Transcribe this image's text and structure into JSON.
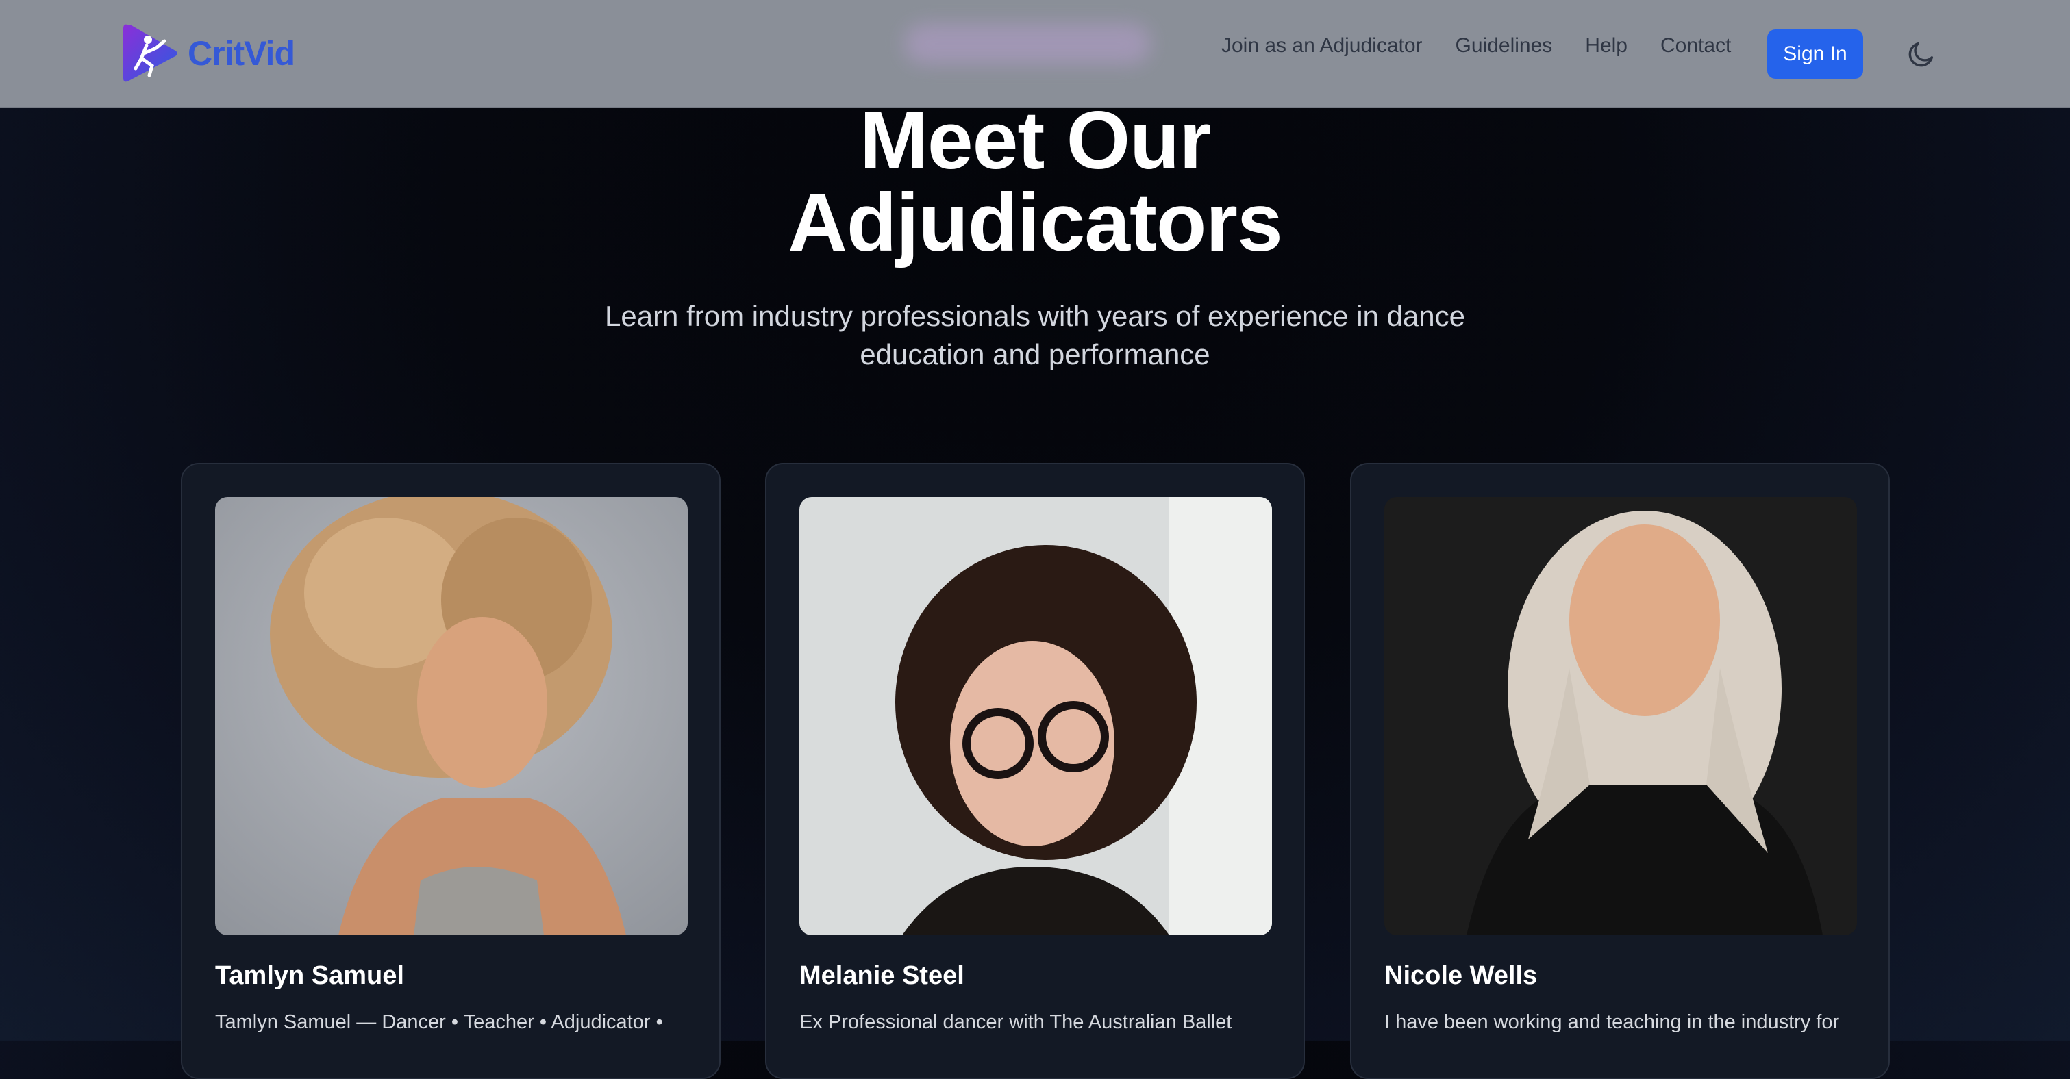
{
  "brand": {
    "name": "CritVid",
    "logo_icon": "play-dancer-logo-icon"
  },
  "nav": {
    "links": [
      {
        "label": "Join as an Adjudicator"
      },
      {
        "label": "Guidelines"
      },
      {
        "label": "Help"
      },
      {
        "label": "Contact"
      }
    ],
    "sign_in_label": "Sign In",
    "theme_icon": "moon-icon"
  },
  "hero": {
    "title": "Meet Our Adjudicators",
    "subtitle": "Learn from industry professionals with years of experience in dance education and performance"
  },
  "adjudicators": [
    {
      "name": "Tamlyn Samuel",
      "bio": "Tamlyn Samuel — Dancer • Teacher • Adjudicator •",
      "photo_icon": "portrait-photo"
    },
    {
      "name": "Melanie Steel",
      "bio": "Ex Professional dancer with The Australian Ballet",
      "photo_icon": "portrait-photo"
    },
    {
      "name": "Nicole Wells",
      "bio": "I have been working and teaching in the industry for",
      "photo_icon": "portrait-photo"
    }
  ],
  "colors": {
    "accent": "#2563eb",
    "brand": "#3559d6",
    "header_bg": "#8a8f98",
    "page_bg": "#05070d",
    "card_bg": "#131925"
  }
}
